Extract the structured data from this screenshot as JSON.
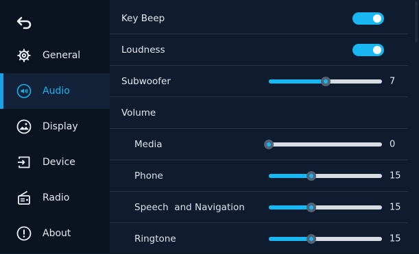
{
  "sidebar": {
    "items": [
      {
        "label": "General",
        "icon": "gear-icon"
      },
      {
        "label": "Audio",
        "icon": "speaker-icon",
        "active": true
      },
      {
        "label": "Display",
        "icon": "display-icon"
      },
      {
        "label": "Device",
        "icon": "device-icon"
      },
      {
        "label": "Radio",
        "icon": "radio-icon"
      },
      {
        "label": "About",
        "icon": "info-icon"
      }
    ]
  },
  "settings": {
    "key_beep": {
      "label": "Key Beep",
      "on": true
    },
    "loudness": {
      "label": "Loudness",
      "on": true
    },
    "subwoofer": {
      "label": "Subwoofer",
      "value": "7",
      "level": 0.5
    },
    "volume": {
      "label": "Volume"
    },
    "media": {
      "label": "Media",
      "value": "0",
      "level": 0.0
    },
    "phone": {
      "label": "Phone",
      "value": "15",
      "level": 0.375
    },
    "speech_navigation": {
      "label": "Speech  and Navigation",
      "value": "15",
      "level": 0.375
    },
    "ringtone": {
      "label": "Ringtone",
      "value": "15",
      "level": 0.375
    }
  },
  "colors": {
    "accent": "#19b7f2",
    "active_text": "#16b6f0",
    "sidebar_bg": "#0b1321",
    "panel_bg": "#0f1b2e"
  }
}
